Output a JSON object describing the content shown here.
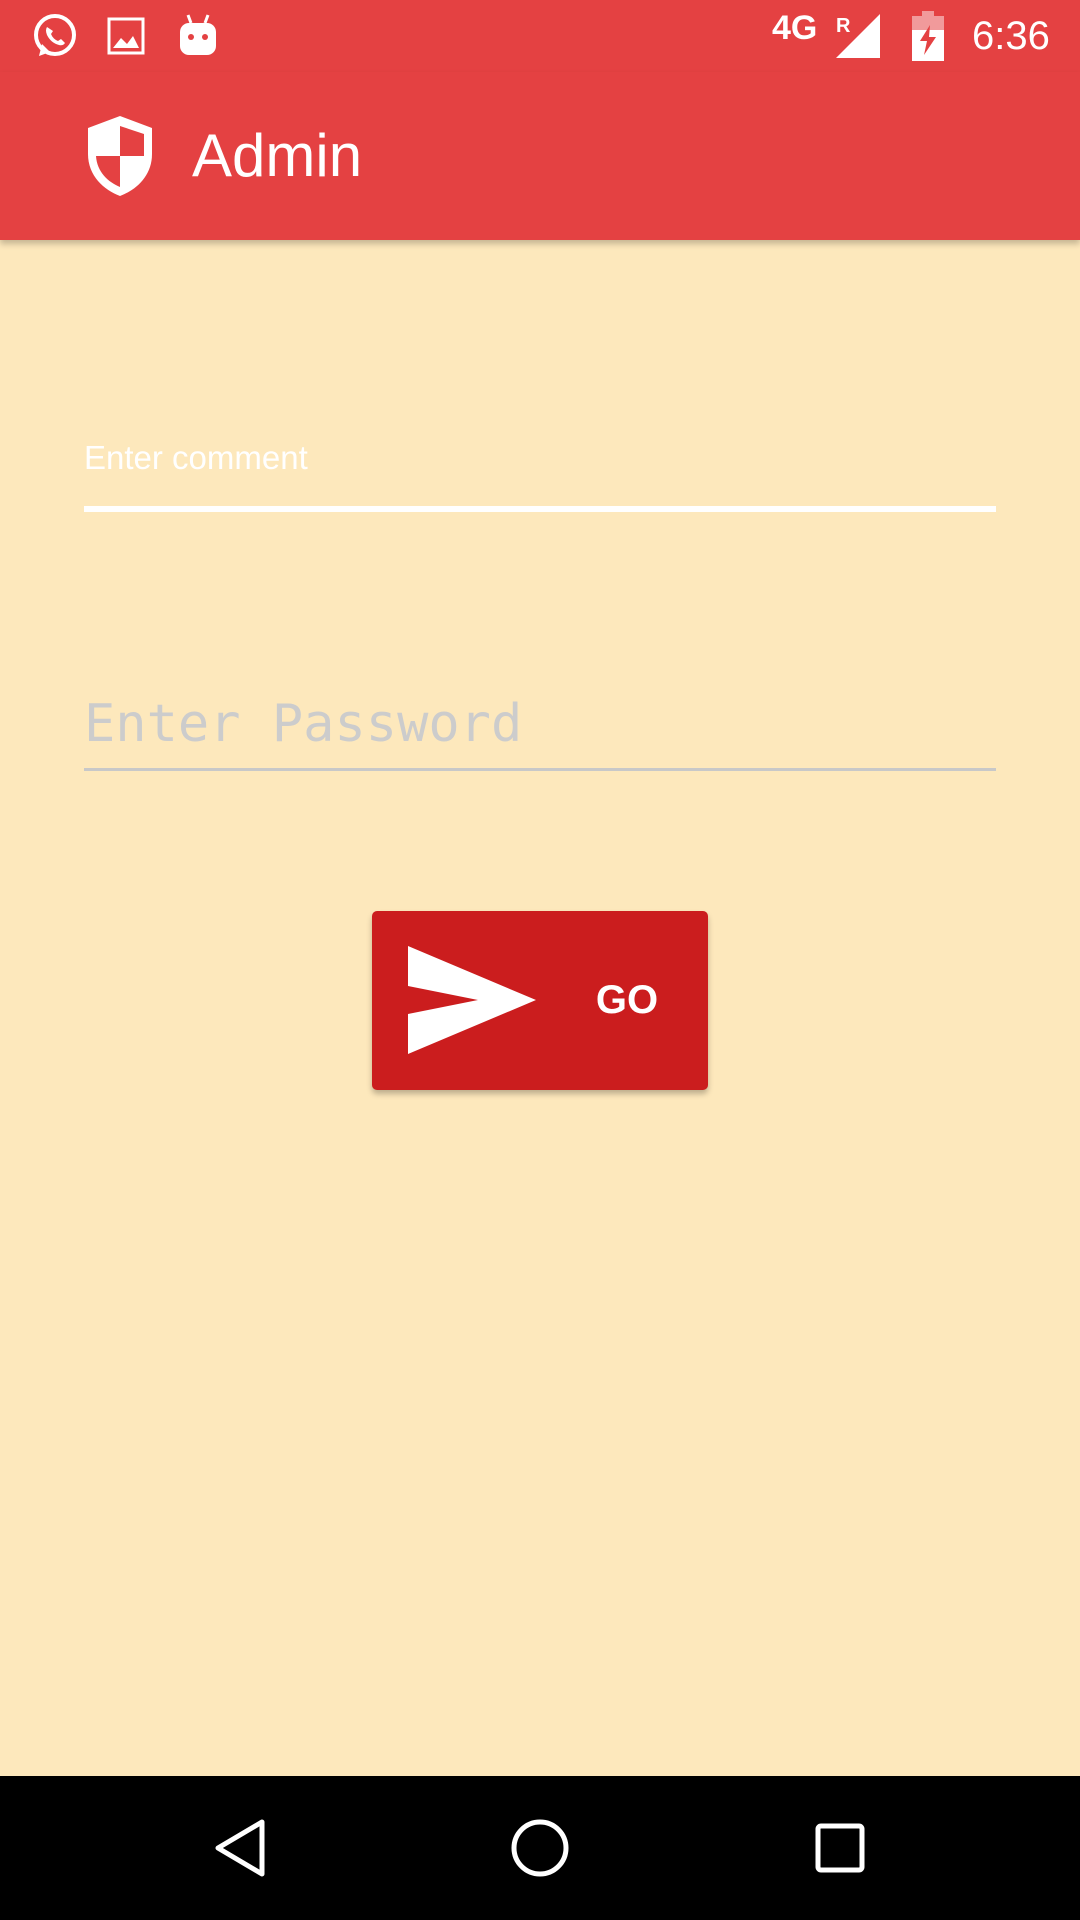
{
  "status_bar": {
    "time": "6:36",
    "network": "4G",
    "roaming": "R",
    "icons": [
      "whatsapp-icon",
      "gallery-icon",
      "android-icon",
      "signal-icon",
      "battery-charging-icon"
    ]
  },
  "app_bar": {
    "title": "Admin",
    "logo_icon": "shield-icon"
  },
  "form": {
    "comment_placeholder": "Enter comment",
    "comment_value": "",
    "password_placeholder": "Enter Password",
    "password_value": "",
    "go_label": "GO",
    "go_icon": "send-icon"
  },
  "nav_bar": {
    "icons": [
      "back-icon",
      "home-icon",
      "recents-icon"
    ]
  },
  "colors": {
    "accent": "#e44142",
    "background": "#fde8bc",
    "button": "#cb1d1e"
  }
}
